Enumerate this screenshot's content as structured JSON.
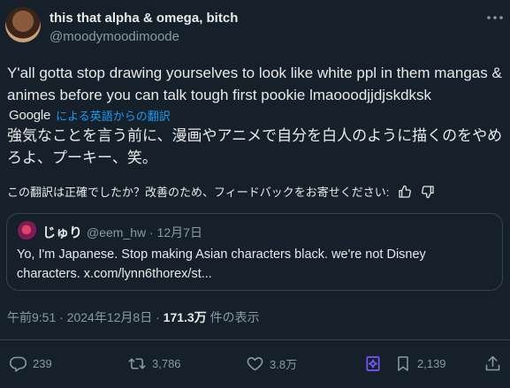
{
  "author": {
    "display_name": "this that alpha & omega, bitch",
    "handle": "@moodymoodimoode"
  },
  "tweet": {
    "text": "Y'all gotta stop drawing yourselves to look like white ppl in them mangas & animes before you can talk tough first pookie lmaooodjjdjskdksk"
  },
  "translation": {
    "provider": "Google",
    "link_label": "による英語からの翻訳",
    "text": "強気なことを言う前に、漫画やアニメで自分を白人のように描くのをやめろよ、プーキー、笑。",
    "feedback_prompt": "この翻訳は正確でしたか？改善のため、フィードバックをお寄せください:"
  },
  "quote": {
    "name": "じゅり",
    "handle": "@eem_hw",
    "separator": "·",
    "date": "12月7日",
    "text": "Yo, I'm Japanese. Stop making Asian characters black. we're not Disney characters. x.com/lynn6thorex/st..."
  },
  "meta": {
    "time": "午前9:51",
    "separator": "·",
    "date": "2024年12月8日",
    "views": "171.3万",
    "views_label": "件の表示"
  },
  "actions": {
    "replies": "239",
    "reposts": "3,786",
    "likes": "3.8万",
    "bookmarks": "2,139"
  },
  "colors": {
    "background": "#15202b",
    "text": "#e7e9ea",
    "secondary": "#8b98a5",
    "accent": "#1d9bf0",
    "grok_purple": "#7856ff",
    "border": "#38444d"
  },
  "icons": [
    "more-icon",
    "thumbs-up-icon",
    "thumbs-down-icon",
    "reply-icon",
    "repost-icon",
    "like-icon",
    "grok-icon",
    "bookmark-icon",
    "share-icon"
  ]
}
